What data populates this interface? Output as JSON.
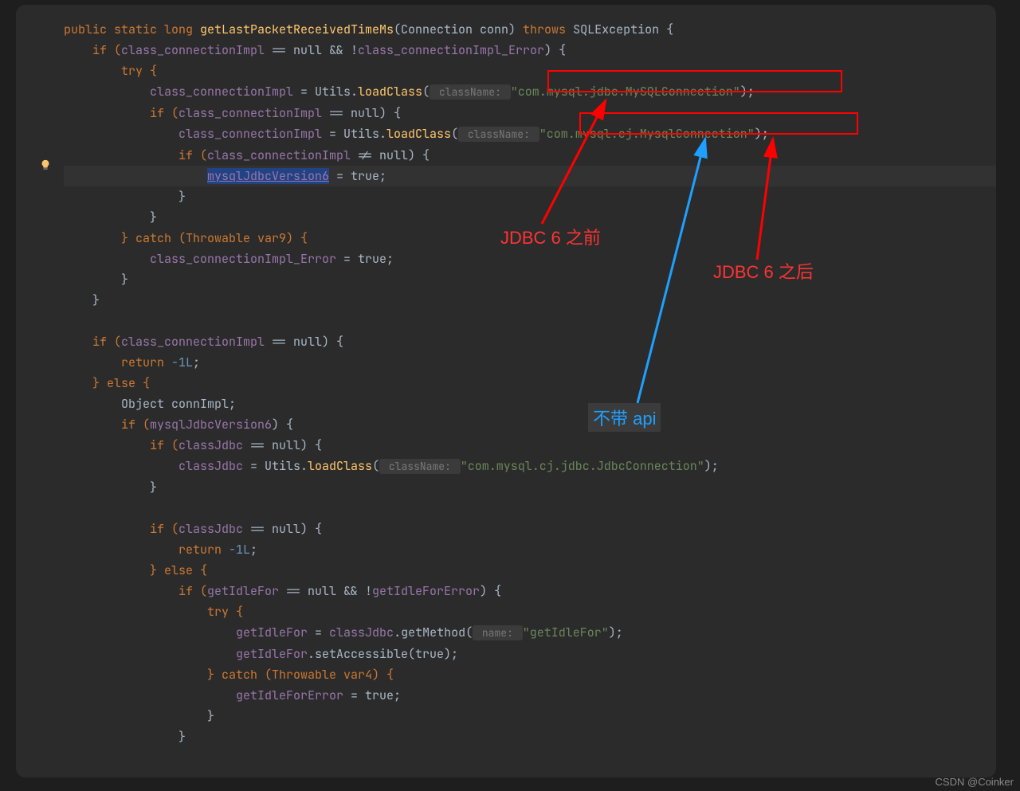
{
  "code": {
    "line1_a": "public static long ",
    "line1_b": "getLastPacketReceivedTimeMs",
    "line1_c": "(Connection conn) ",
    "line1_d": "throws ",
    "line1_e": "SQLException {",
    "line2_a": "    if (",
    "line2_b": "class_connectionImpl",
    "line2_c": " == null && !",
    "line2_d": "class_connectionImpl_Error",
    "line2_e": ") {",
    "line3": "        try {",
    "line4_a": "            ",
    "line4_b": "class_connectionImpl",
    "line4_c": " = Utils.",
    "line4_d": "loadClass",
    "line4_e": "(",
    "line4_hint": " className: ",
    "line4_f": "\"com.mysql.jdbc.MySQLConnection\"",
    "line4_g": ");",
    "line5_a": "            if (",
    "line5_b": "class_connectionImpl",
    "line5_c": " == null) {",
    "line6_a": "                ",
    "line6_b": "class_connectionImpl",
    "line6_c": " = Utils.",
    "line6_d": "loadClass",
    "line6_e": "(",
    "line6_hint": " className: ",
    "line6_f": "\"com.mysql.cj.MysqlConnection\"",
    "line6_g": ");",
    "line7_a": "                if (",
    "line7_b": "class_connectionImpl",
    "line7_c": " != null) {",
    "line8_a": "                    ",
    "line8_b": "mysqlJdbcVersion6",
    "line8_c": " = true;",
    "line9": "                }",
    "line10": "            }",
    "line11_a": "        } catch (Throwable var9) {",
    "line12_a": "            ",
    "line12_b": "class_connectionImpl_Error",
    "line12_c": " = true;",
    "line13": "        }",
    "line14": "    }",
    "line15": "",
    "line16_a": "    if (",
    "line16_b": "class_connectionImpl",
    "line16_c": " == null) {",
    "line17_a": "        return ",
    "line17_b": "-1L",
    "line17_c": ";",
    "line18_a": "    } else {",
    "line19": "        Object connImpl;",
    "line20_a": "        if (",
    "line20_b": "mysqlJdbcVersion6",
    "line20_c": ") {",
    "line21_a": "            if (",
    "line21_b": "classJdbc",
    "line21_c": " == null) {",
    "line22_a": "                ",
    "line22_b": "classJdbc",
    "line22_c": " = Utils.",
    "line22_d": "loadClass",
    "line22_e": "(",
    "line22_hint": " className: ",
    "line22_f": "\"com.mysql.cj.jdbc.JdbcConnection\"",
    "line22_g": ");",
    "line23": "            }",
    "line24": "",
    "line25_a": "            if (",
    "line25_b": "classJdbc",
    "line25_c": " == null) {",
    "line26_a": "                return ",
    "line26_b": "-1L",
    "line26_c": ";",
    "line27_a": "            } else {",
    "line28_a": "                if (",
    "line28_b": "getIdleFor",
    "line28_c": " == null && !",
    "line28_d": "getIdleForError",
    "line28_e": ") {",
    "line29": "                    try {",
    "line30_a": "                        ",
    "line30_b": "getIdleFor",
    "line30_c": " = ",
    "line30_d": "classJdbc",
    "line30_e": ".getMethod(",
    "line30_hint": " name: ",
    "line30_f": "\"getIdleFor\"",
    "line30_g": ");",
    "line31_a": "                        ",
    "line31_b": "getIdleFor",
    "line31_c": ".setAccessible(true);",
    "line32_a": "                    } catch (Throwable var4) {",
    "line33_a": "                        ",
    "line33_b": "getIdleForError",
    "line33_c": " = true;",
    "line34": "                    }",
    "line35": "                }"
  },
  "annotations": {
    "jdbc_before": "JDBC 6 之前",
    "jdbc_after": "JDBC 6 之后",
    "no_api": "不带 api"
  },
  "watermark": "CSDN @Coinker"
}
